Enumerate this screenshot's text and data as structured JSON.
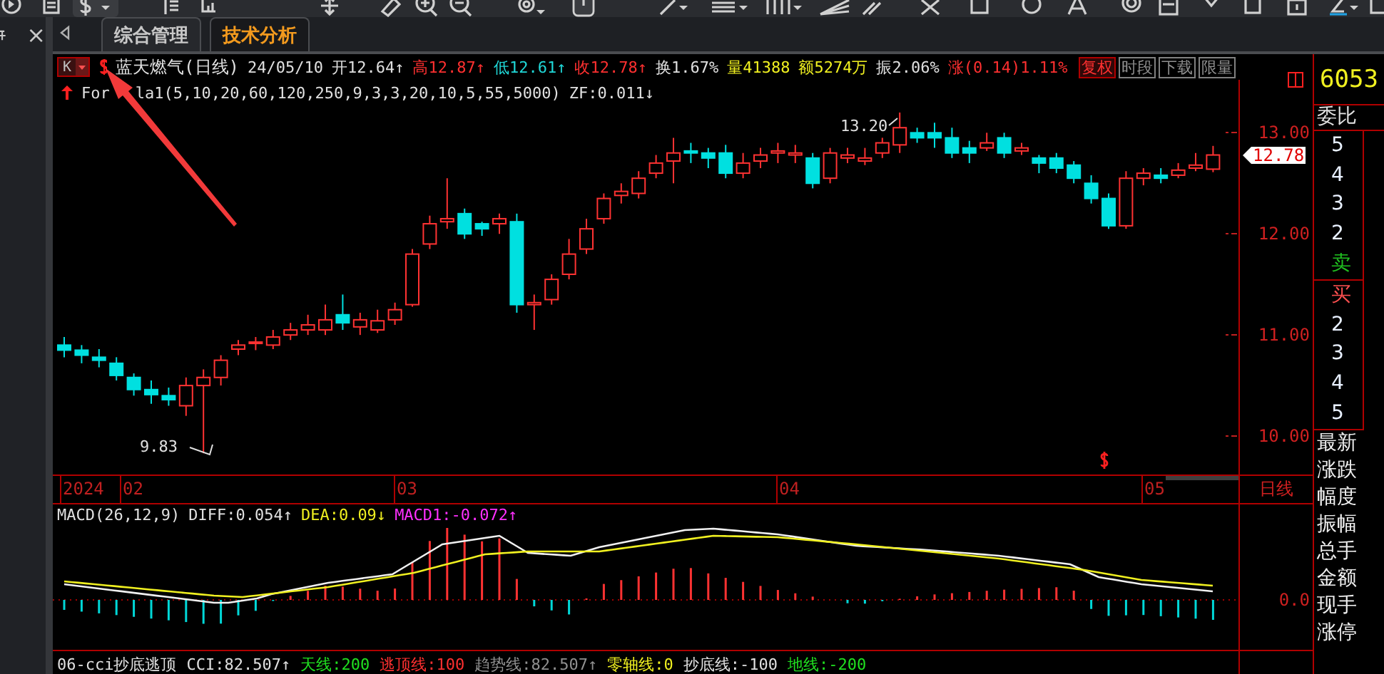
{
  "tabs": [
    {
      "label": "综合管理",
      "selected": false
    },
    {
      "label": "技术分析",
      "selected": true
    }
  ],
  "left_panel": {
    "close": "×"
  },
  "quote": {
    "period_button": "K",
    "title": "蓝天燃气(日线)",
    "date": "24/05/10",
    "fields": [
      {
        "text": "开12.64↑",
        "color": "#e0e0e0"
      },
      {
        "text": "高12.87↑",
        "color": "#ff3030"
      },
      {
        "text": "低12.61↑",
        "color": "#20d8d8"
      },
      {
        "text": "收12.78↑",
        "color": "#ff3030"
      },
      {
        "text": "换1.67%",
        "color": "#e0e0e0"
      },
      {
        "text": "量41388",
        "color": "#f0f020"
      },
      {
        "text": "额5274万",
        "color": "#f0f020"
      },
      {
        "text": "振2.06%",
        "color": "#e0e0e0"
      },
      {
        "text": "涨(0.14)1.11%",
        "color": "#ff3030"
      }
    ],
    "buttons": [
      {
        "label": "复权",
        "selected": true
      },
      {
        "label": "时段",
        "selected": false
      },
      {
        "label": "下载",
        "selected": false
      },
      {
        "label": "限量",
        "selected": false
      }
    ]
  },
  "formula": {
    "text_before_arrow": "For",
    "text_after_arrow": "la1(5,10,20,60,120,250,9,3,3,20,10,5,55,5000)",
    "zf": "ZF:0.011↓"
  },
  "main_chart": {
    "chart_data": {
      "type": "candlestick",
      "ohlc": [
        [
          10.9,
          10.98,
          10.78,
          10.85
        ],
        [
          10.85,
          10.9,
          10.72,
          10.8
        ],
        [
          10.78,
          10.86,
          10.68,
          10.75
        ],
        [
          10.72,
          10.78,
          10.55,
          10.6
        ],
        [
          10.58,
          10.62,
          10.4,
          10.46
        ],
        [
          10.46,
          10.55,
          10.32,
          10.41
        ],
        [
          10.4,
          10.48,
          10.3,
          10.36
        ],
        [
          10.3,
          10.58,
          10.2,
          10.5
        ],
        [
          10.5,
          10.66,
          9.83,
          10.58
        ],
        [
          10.58,
          10.8,
          10.5,
          10.75
        ],
        [
          10.86,
          10.95,
          10.8,
          10.9
        ],
        [
          10.92,
          10.98,
          10.85,
          10.93
        ],
        [
          10.9,
          11.05,
          10.86,
          10.98
        ],
        [
          11.0,
          11.12,
          10.95,
          11.05
        ],
        [
          11.05,
          11.2,
          11.0,
          11.1
        ],
        [
          11.05,
          11.3,
          11.0,
          11.15
        ],
        [
          11.2,
          11.4,
          11.05,
          11.12
        ],
        [
          11.08,
          11.22,
          11.0,
          11.15
        ],
        [
          11.05,
          11.25,
          11.02,
          11.14
        ],
        [
          11.15,
          11.32,
          11.1,
          11.25
        ],
        [
          11.3,
          11.85,
          11.28,
          11.8
        ],
        [
          11.9,
          12.18,
          11.85,
          12.1
        ],
        [
          12.12,
          12.55,
          12.05,
          12.15
        ],
        [
          12.2,
          12.25,
          11.95,
          12.0
        ],
        [
          12.1,
          12.12,
          11.98,
          12.05
        ],
        [
          12.1,
          12.2,
          12.0,
          12.15
        ],
        [
          12.12,
          12.2,
          11.22,
          11.3
        ],
        [
          11.3,
          11.4,
          11.05,
          11.32
        ],
        [
          11.35,
          11.6,
          11.3,
          11.55
        ],
        [
          11.6,
          11.95,
          11.55,
          11.8
        ],
        [
          11.85,
          12.15,
          11.8,
          12.05
        ],
        [
          12.15,
          12.4,
          12.1,
          12.35
        ],
        [
          12.38,
          12.5,
          12.3,
          12.42
        ],
        [
          12.4,
          12.62,
          12.35,
          12.55
        ],
        [
          12.6,
          12.78,
          12.55,
          12.7
        ],
        [
          12.72,
          12.95,
          12.5,
          12.8
        ],
        [
          12.82,
          12.9,
          12.7,
          12.8
        ],
        [
          12.8,
          12.85,
          12.65,
          12.75
        ],
        [
          12.8,
          12.88,
          12.55,
          12.6
        ],
        [
          12.6,
          12.8,
          12.55,
          12.7
        ],
        [
          12.72,
          12.85,
          12.65,
          12.78
        ],
        [
          12.8,
          12.9,
          12.7,
          12.82
        ],
        [
          12.78,
          12.88,
          12.7,
          12.8
        ],
        [
          12.75,
          12.8,
          12.45,
          12.5
        ],
        [
          12.55,
          12.85,
          12.5,
          12.8
        ],
        [
          12.75,
          12.85,
          12.7,
          12.78
        ],
        [
          12.72,
          12.85,
          12.68,
          12.75
        ],
        [
          12.8,
          12.95,
          12.75,
          12.9
        ],
        [
          12.88,
          13.2,
          12.8,
          13.05
        ],
        [
          13.0,
          13.05,
          12.9,
          12.95
        ],
        [
          13.0,
          13.1,
          12.85,
          12.95
        ],
        [
          12.95,
          13.05,
          12.75,
          12.8
        ],
        [
          12.85,
          12.92,
          12.7,
          12.8
        ],
        [
          12.85,
          13.0,
          12.82,
          12.9
        ],
        [
          12.95,
          13.0,
          12.75,
          12.8
        ],
        [
          12.82,
          12.9,
          12.78,
          12.85
        ],
        [
          12.75,
          12.78,
          12.6,
          12.7
        ],
        [
          12.75,
          12.8,
          12.6,
          12.65
        ],
        [
          12.68,
          12.72,
          12.5,
          12.55
        ],
        [
          12.5,
          12.58,
          12.3,
          12.35
        ],
        [
          12.35,
          12.4,
          12.05,
          12.08
        ],
        [
          12.08,
          12.62,
          12.05,
          12.55
        ],
        [
          12.55,
          12.65,
          12.48,
          12.6
        ],
        [
          12.58,
          12.65,
          12.5,
          12.55
        ],
        [
          12.58,
          12.7,
          12.55,
          12.63
        ],
        [
          12.65,
          12.8,
          12.62,
          12.68
        ],
        [
          12.64,
          12.87,
          12.61,
          12.78
        ]
      ],
      "ylim": [
        9.62,
        13.27
      ],
      "yticks": [
        {
          "value": 13,
          "label": "13.00"
        },
        {
          "value": 12,
          "label": "12.00"
        },
        {
          "value": 11,
          "label": "11.00"
        },
        {
          "value": 10,
          "label": "10.00"
        }
      ]
    }
  },
  "price_axis": {
    "current": "12.78",
    "period": "日线",
    "macd_zero": "0.0"
  },
  "chart_marks": {
    "high": "13.20",
    "low": "9.83"
  },
  "date_axis": [
    "2024",
    "02",
    "03",
    "04",
    "05"
  ],
  "macd": {
    "items": [
      {
        "text": "MACD(26,12,9)",
        "color": "#e0e0e0"
      },
      {
        "text": "DIFF:0.054↑",
        "color": "#e0e0e0"
      },
      {
        "text": "DEA:0.09↓",
        "color": "#f0f020"
      },
      {
        "text": "MACD1:-0.072↑",
        "color": "#ff30ff"
      }
    ]
  },
  "cci": {
    "items": [
      {
        "text": "06-cci抄底逃顶",
        "color": "#e0e0e0"
      },
      {
        "text": "CCI:82.507↑",
        "color": "#e0e0e0"
      },
      {
        "text": "天线:200",
        "color": "#20e020"
      },
      {
        "text": "逃顶线:100",
        "color": "#ff3030"
      },
      {
        "text": "趋势线:82.507↑",
        "color": "#909090"
      },
      {
        "text": "零轴线:0",
        "color": "#f0f020"
      },
      {
        "text": "抄底线:-100",
        "color": "#e0e0e0"
      },
      {
        "text": "地线:-200",
        "color": "#20e020"
      }
    ]
  },
  "order_book": {
    "code": "6053",
    "ratio_label": "委比",
    "sell_levels": [
      "5",
      "4",
      "3",
      "2"
    ],
    "sell_label": "卖",
    "buy_label": "买",
    "buy_levels": [
      "2",
      "3",
      "4",
      "5"
    ]
  },
  "stats": [
    "最新",
    "涨跌",
    "幅度",
    "振幅",
    "总手",
    "金额",
    "现手",
    "涨停"
  ]
}
